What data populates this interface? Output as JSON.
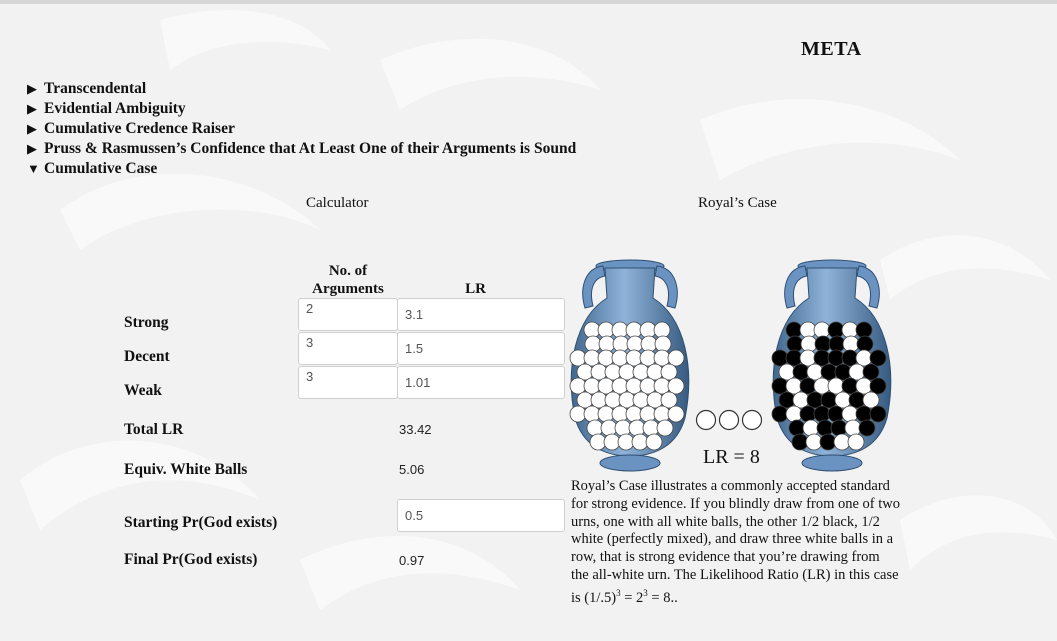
{
  "page": {
    "title": "META"
  },
  "menu": {
    "items": [
      {
        "label": "Transcendental",
        "expanded": false
      },
      {
        "label": "Evidential Ambiguity",
        "expanded": false
      },
      {
        "label": "Cumulative Credence Raiser",
        "expanded": false
      },
      {
        "label": "Pruss & Rasmussen’s Confidence that At Least One of their Arguments is Sound",
        "expanded": false
      },
      {
        "label": "Cumulative Case",
        "expanded": true
      }
    ],
    "collapsed_glyph": "▶",
    "expanded_glyph": "▼"
  },
  "calculator": {
    "heading": "Calculator",
    "col_args": "No. of Arguments",
    "col_args_line1": "No. of",
    "col_args_line2": "Arguments",
    "col_lr": "LR",
    "rows": [
      {
        "label": "Strong",
        "args": "2",
        "lr": "3.1"
      },
      {
        "label": "Decent",
        "args": "3",
        "lr": "1.5"
      },
      {
        "label": "Weak",
        "args": "3",
        "lr": "1.01"
      }
    ],
    "total_lr_label": "Total LR",
    "total_lr_value": "33.42",
    "equiv_label": "Equiv. White Balls",
    "equiv_value": "5.06",
    "starting_label": "Starting Pr(God exists)",
    "starting_value": "0.5",
    "final_label": "Final Pr(God exists)",
    "final_value": "0.97"
  },
  "royal": {
    "heading": "Royal’s Case",
    "lr_label": "LR = 8",
    "drawn_balls": 3,
    "urn_color": "#6a93c2",
    "description_part1": "Royal’s Case illustrates a commonly accepted standard for strong evidence. If you blindly draw from one of two urns, one with all white balls, the other 1/2 black, 1/2 white (perfectly mixed), and draw three white balls in a row, that is strong evidence that you’re drawing from the all-white urn. The Likelihood Ratio (LR) in this case is (1/.5)",
    "description_exp1": "3",
    "description_mid": " = 2",
    "description_exp2": "3",
    "description_end": " = 8.."
  }
}
